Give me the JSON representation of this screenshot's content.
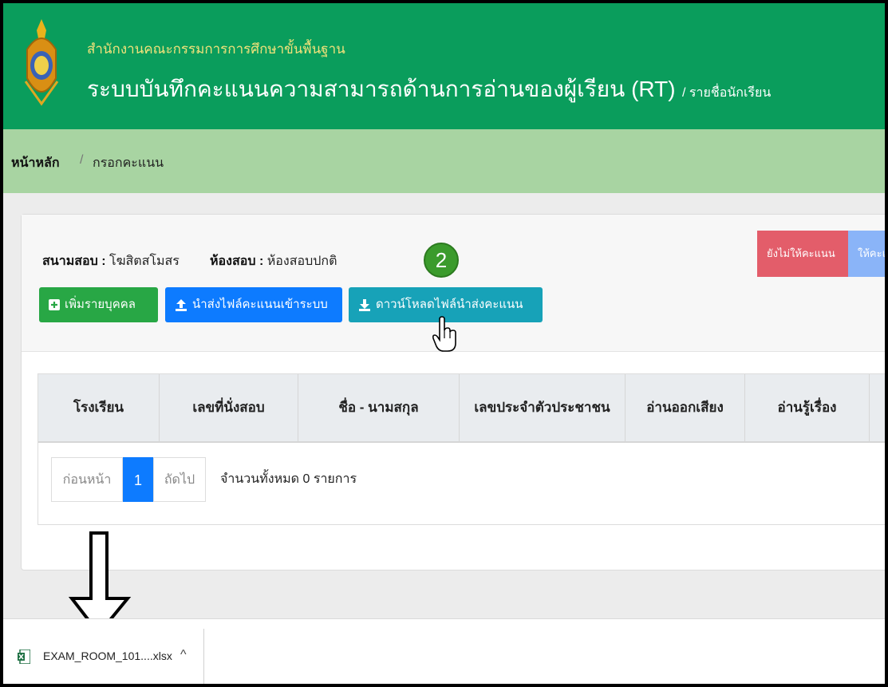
{
  "header": {
    "org": "สำนักงานคณะกรรมการการศึกษาขั้นพื้นฐาน",
    "title": "ระบบบันทึกคะแนนความสามารถด้านการอ่านของผู้เรียน (RT)",
    "subtitle": "/ รายชื่อนักเรียน"
  },
  "breadcrumb": {
    "home": "หน้าหลัก",
    "separator": "/",
    "current": "กรอกคะแนน"
  },
  "info": {
    "venue_label": "สนามสอบ :",
    "venue_value": "โฆสิตสโมสร",
    "room_label": "ห้องสอบ :",
    "room_value": "ห้องสอบปกติ"
  },
  "step_marker": "2",
  "status_buttons": {
    "not_scored": "ยังไม่ให้คะแนน",
    "scored": "ให้คะแน"
  },
  "buttons": {
    "add_person": "เพิ่มรายบุคคล",
    "upload": "นำส่งไฟล์คะแนนเข้าระบบ",
    "download": "ดาวน์โหลดไฟล์นำส่งคะแนน"
  },
  "table": {
    "columns": [
      "โรงเรียน",
      "เลขที่นั่งสอบ",
      "ชื่อ - นามสกุล",
      "เลขประจำตัวประชาชน",
      "อ่านออกเสียง",
      "อ่านรู้เรื่อง"
    ]
  },
  "pagination": {
    "prev": "ก่อนหน้า",
    "current": "1",
    "next": "ถัดไป",
    "total": "จำนวนทั้งหมด 0 รายการ"
  },
  "download_bar": {
    "filename": "EXAM_ROOM_101....xlsx",
    "chevron": "^"
  },
  "colors": {
    "header": "#0a9d5c",
    "breadcrumb_bg": "#a8d4a2",
    "btn_green": "#28a745",
    "btn_blue": "#0d7bff",
    "btn_teal": "#17a2b8",
    "status_red": "#e35d6a",
    "status_lightblue": "#8ab4f8"
  }
}
